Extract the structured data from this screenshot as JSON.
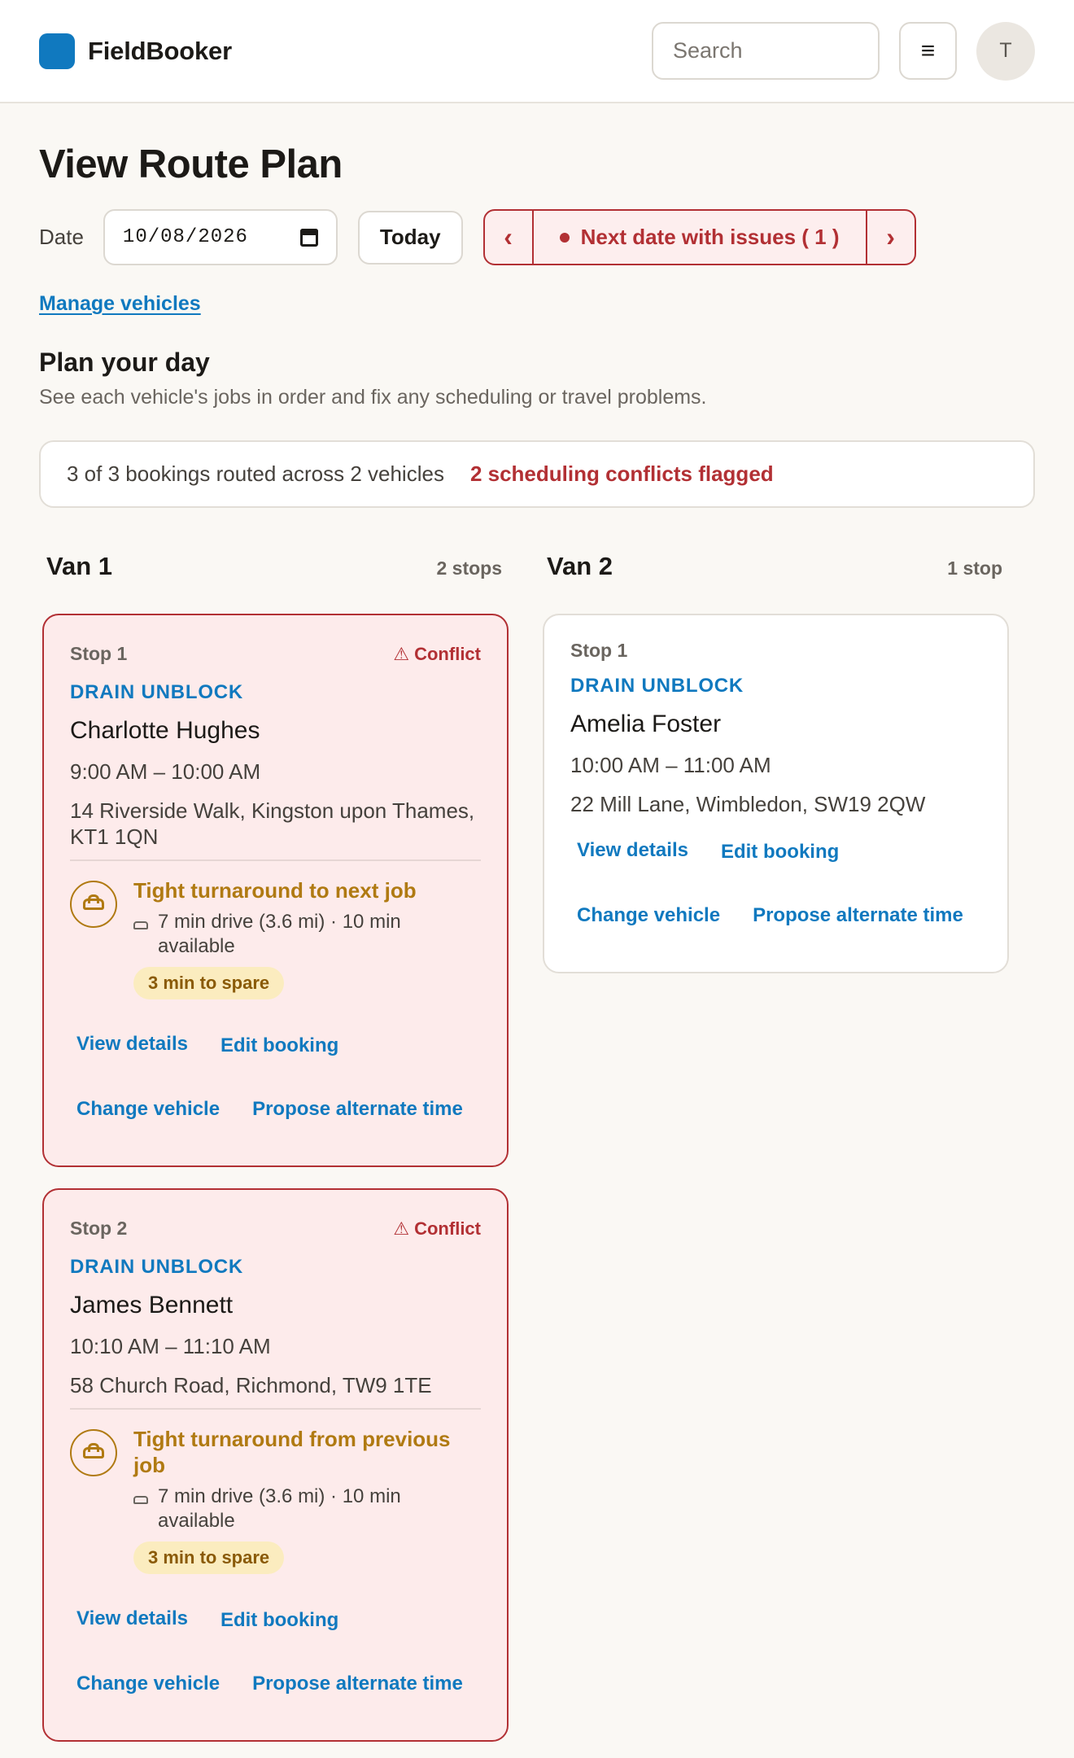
{
  "header": {
    "brand": "FieldBooker",
    "search_placeholder": "Search",
    "menu_glyph": "≡",
    "avatar_initial": "T"
  },
  "page": {
    "title": "View Route Plan",
    "date_label": "Date",
    "date_value": "10/08/2026",
    "today_label": "Today",
    "prev_glyph": "‹",
    "next_glyph": "›",
    "next_issues_label": "Next date with issues ( 1 )",
    "manage_vehicles": "Manage vehicles"
  },
  "plan": {
    "title": "Plan your day",
    "subtitle": "See each vehicle's jobs in order and fix any scheduling or travel problems.",
    "summary": "3 of 3 bookings routed across 2 vehicles",
    "conflicts": "2 scheduling conflicts flagged"
  },
  "vehicles": [
    {
      "name": "Van 1",
      "count": "2 stops",
      "stops": [
        {
          "stop": "Stop 1",
          "conflict": "Conflict",
          "type": "DRAIN UNBLOCK",
          "customer": "Charlotte Hughes",
          "time": "9:00 AM – 10:00 AM",
          "address": "14 Riverside Walk, Kingston upon Thames, KT1 1QN",
          "travel_title": "Tight turnaround to next job",
          "travel_detail": "7 min drive (3.6 mi) · 10 min available",
          "spare": "3 min to spare"
        },
        {
          "stop": "Stop 2",
          "conflict": "Conflict",
          "type": "DRAIN UNBLOCK",
          "customer": "James Bennett",
          "time": "10:10 AM – 11:10 AM",
          "address": "58 Church Road, Richmond, TW9 1TE",
          "travel_title": "Tight turnaround from previous job",
          "travel_detail": "7 min drive (3.6 mi) · 10 min available",
          "spare": "3 min to spare"
        }
      ]
    },
    {
      "name": "Van 2",
      "count": "1 stop",
      "stops": [
        {
          "stop": "Stop 1",
          "type": "DRAIN UNBLOCK",
          "customer": "Amelia Foster",
          "time": "10:00 AM – 11:00 AM",
          "address": "22 Mill Lane, Wimbledon, SW19 2QW"
        }
      ]
    }
  ],
  "actions": {
    "view_details": "View details",
    "edit_booking": "Edit booking",
    "change_vehicle": "Change vehicle",
    "propose_time": "Propose alternate time"
  },
  "icons": {
    "conflict": "warning-icon",
    "travel": "car-icon"
  },
  "colors": {
    "accent": "#1079bf",
    "danger": "#b23034",
    "warning": "#b07a12"
  }
}
